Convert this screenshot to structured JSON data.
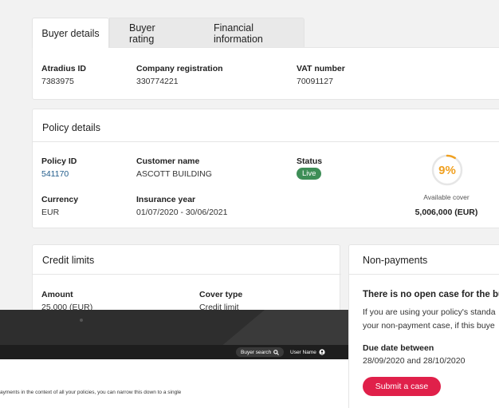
{
  "tabs": {
    "active": "Buyer details",
    "rating": "Buyer rating",
    "financial": "Financial information"
  },
  "buyer": {
    "atradius_label": "Atradius ID",
    "atradius_value": "7383975",
    "company_label": "Company registration",
    "company_value": "330774221",
    "vat_label": "VAT number",
    "vat_value": "70091127"
  },
  "policy": {
    "title": "Policy details",
    "policy_id_label": "Policy ID",
    "policy_id_value": "541170",
    "customer_label": "Customer name",
    "customer_value": "ASCOTT BUILDING",
    "status_label": "Status",
    "status_value": "Live",
    "currency_label": "Currency",
    "currency_value": "EUR",
    "insurance_label": "Insurance year",
    "insurance_value": "01/07/2020 - 30/06/2021",
    "gauge_text": "9%",
    "gauge_fraction": 0.09,
    "available_label": "Available cover",
    "available_value": "5,006,000 (EUR)"
  },
  "credit": {
    "title": "Credit limits",
    "amount_label": "Amount",
    "amount_value": "25,000 (EUR)",
    "cover_label": "Cover type",
    "cover_value": "Credit limit"
  },
  "nonpay": {
    "title": "Non-payments",
    "heading": "There is no open case for the bu",
    "text1": "If you are using your policy's standa",
    "text2": "your non-payment case, if this buye",
    "due_label": "Due date between",
    "due_value": "28/09/2020 and 28/10/2020",
    "submit": "Submit a case"
  },
  "laptop": {
    "buyer_search": "Buyer search",
    "user_name": "User Name",
    "screen_text": "ayments in the context of all your policies, you can narrow this down to a single"
  },
  "colors": {
    "accent_red": "#e0204a",
    "live_green": "#3e8e57",
    "gauge_orange": "#f0a020",
    "link_blue": "#1f5b8a"
  }
}
